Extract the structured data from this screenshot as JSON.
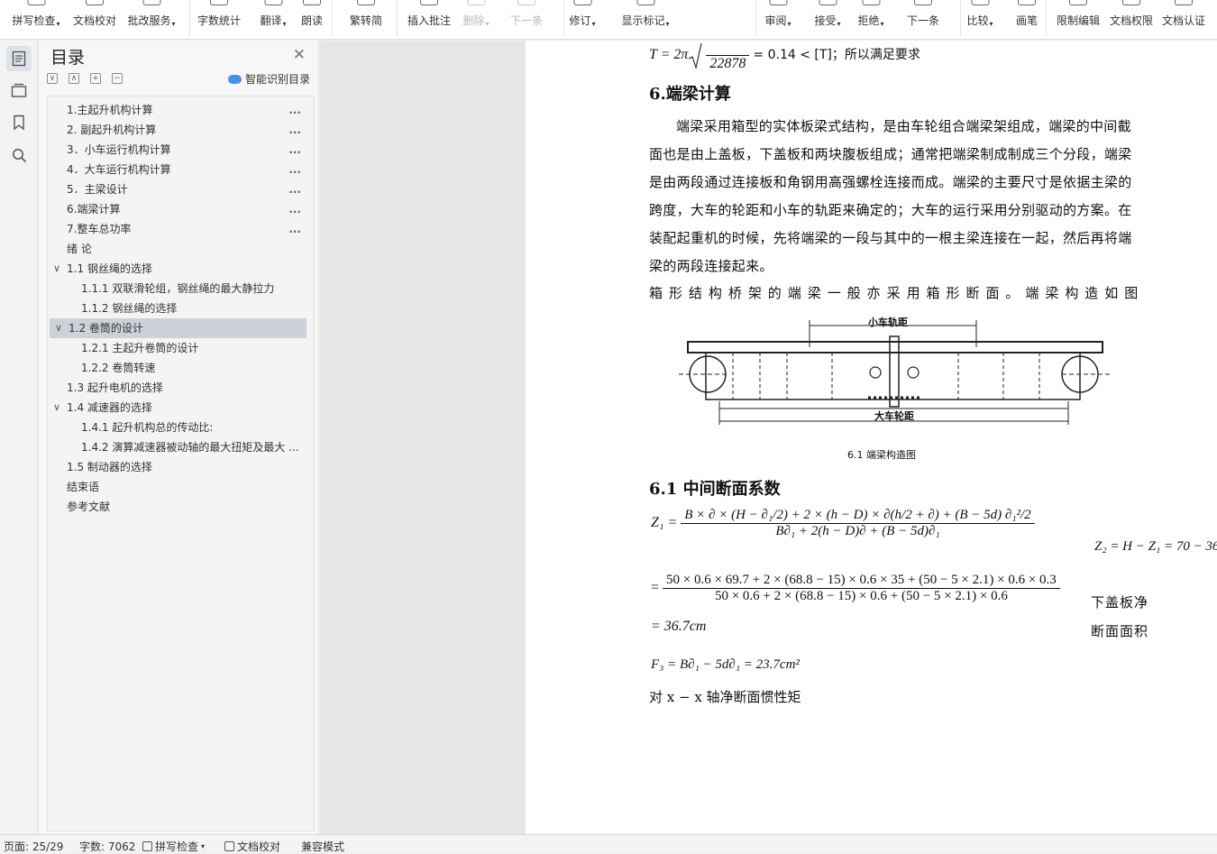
{
  "ribbon": {
    "items": [
      {
        "label": "拼写检查",
        "icon": "spell-check-icon",
        "caret": true,
        "disabled": false
      },
      {
        "label": "文档校对",
        "icon": "proofread-icon",
        "caret": false,
        "disabled": false
      },
      {
        "label": "批改服务",
        "icon": "correction-service-icon",
        "caret": true,
        "disabled": false
      },
      {
        "label": "字数统计",
        "icon": "word-count-icon",
        "caret": false,
        "disabled": false
      },
      {
        "label": "翻译",
        "icon": "translate-icon",
        "caret": true,
        "disabled": false
      },
      {
        "label": "朗读",
        "icon": "read-aloud-icon",
        "caret": false,
        "disabled": false
      },
      {
        "label": "繁转简",
        "icon": "trad-to-simp-icon",
        "caret": false,
        "disabled": false
      },
      {
        "label": "插入批注",
        "icon": "insert-comment-icon",
        "caret": false,
        "disabled": false
      },
      {
        "label": "删除",
        "icon": "delete-comment-icon",
        "caret": true,
        "disabled": true
      },
      {
        "label": "下一条",
        "icon": "next-comment-icon",
        "caret": false,
        "disabled": true
      },
      {
        "label": "修订",
        "icon": "track-changes-icon",
        "caret": true,
        "disabled": false
      },
      {
        "label": "显示标记",
        "icon": "show-markup-icon",
        "caret": true,
        "disabled": false
      },
      {
        "label": "审阅",
        "icon": "review-icon",
        "caret": true,
        "disabled": false
      },
      {
        "label": "接受",
        "icon": "accept-icon",
        "caret": true,
        "disabled": false
      },
      {
        "label": "拒绝",
        "icon": "reject-icon",
        "caret": true,
        "disabled": false
      },
      {
        "label": "下一条",
        "icon": "next-change-icon",
        "caret": false,
        "disabled": false
      },
      {
        "label": "比较",
        "icon": "compare-icon",
        "caret": true,
        "disabled": false
      },
      {
        "label": "画笔",
        "icon": "pen-icon",
        "caret": false,
        "disabled": false
      },
      {
        "label": "限制编辑",
        "icon": "restrict-editing-icon",
        "caret": false,
        "disabled": false
      },
      {
        "label": "文档权限",
        "icon": "document-permission-icon",
        "caret": false,
        "disabled": false
      },
      {
        "label": "文档认证",
        "icon": "document-certify-icon",
        "caret": false,
        "disabled": false
      }
    ]
  },
  "toc": {
    "title": "目录",
    "smart_label": "智能识别目录",
    "items": [
      {
        "label": "1.主起升机构计算",
        "indent": 0,
        "dots": true,
        "arrow": ""
      },
      {
        "label": "2. 副起升机构计算",
        "indent": 0,
        "dots": true,
        "arrow": ""
      },
      {
        "label": "3．小车运行机构计算",
        "indent": 0,
        "dots": true,
        "arrow": ""
      },
      {
        "label": "4．大车运行机构计算",
        "indent": 0,
        "dots": true,
        "arrow": ""
      },
      {
        "label": "5．主梁设计",
        "indent": 0,
        "dots": true,
        "arrow": ""
      },
      {
        "label": "6.端梁计算",
        "indent": 0,
        "dots": true,
        "arrow": ""
      },
      {
        "label": "7.整车总功率",
        "indent": 0,
        "dots": true,
        "arrow": ""
      },
      {
        "label": "绪 论",
        "indent": 0,
        "dots": false,
        "arrow": ""
      },
      {
        "label": "1.1 钢丝绳的选择",
        "indent": 0,
        "dots": false,
        "arrow": "∨"
      },
      {
        "label": "1.1.1 双联滑轮组，钢丝绳的最大静拉力",
        "indent": 1,
        "dots": false,
        "arrow": ""
      },
      {
        "label": "1.1.2 钢丝绳的选择",
        "indent": 1,
        "dots": false,
        "arrow": ""
      },
      {
        "label": "1.2 卷筒的设计",
        "indent": 0,
        "dots": false,
        "arrow": "∨",
        "selected": true
      },
      {
        "label": "1.2.1 主起升卷筒的设计",
        "indent": 1,
        "dots": false,
        "arrow": ""
      },
      {
        "label": "1.2.2 卷筒转速",
        "indent": 1,
        "dots": false,
        "arrow": ""
      },
      {
        "label": "1.3 起升电机的选择",
        "indent": 0,
        "dots": false,
        "arrow": ""
      },
      {
        "label": "1.4 减速器的选择",
        "indent": 0,
        "dots": false,
        "arrow": "∨"
      },
      {
        "label": "1.4.1 起升机构总的传动比:",
        "indent": 1,
        "dots": false,
        "arrow": ""
      },
      {
        "label": "1.4.2 演算减速器被动轴的最大扭矩及最大 ...",
        "indent": 1,
        "dots": false,
        "arrow": ""
      },
      {
        "label": "1.5 制动器的选择",
        "indent": 0,
        "dots": false,
        "arrow": ""
      },
      {
        "label": "结束语",
        "indent": 0,
        "dots": false,
        "arrow": ""
      },
      {
        "label": "参考文献",
        "indent": 0,
        "dots": false,
        "arrow": ""
      }
    ]
  },
  "document": {
    "top_formula_den": "22878",
    "top_formula_rest": "= 0.14 < [T]；所以满足要求",
    "section_heading": "6.端梁计算",
    "para_lines": [
      "端梁采用箱型的实体板梁式结构，是由车轮组合端梁架组成，端梁的中间截",
      "面也是由上盖板，下盖板和两块腹板组成；通常把端梁制成制成三个分段，端梁",
      "是由两段通过连接板和角钢用高强螺栓连接而成。端梁的主要尺寸是依据主梁的",
      "跨度，大车的轮距和小车的轨距来确定的；大车的运行采用分别驱动的方案。在",
      "装配起重机的时候，先将端梁的一段与其中的一根主梁连接在一起，然后再将端",
      "梁的两段连接起来。"
    ],
    "para_spaced": "箱 形 结 构 桥 架 的 端 梁 一 般 亦 采 用 箱 形 断 面 。 端 梁 构 造 如 图",
    "figure_top_label": "小车轨距",
    "figure_bottom_label": "大车轮距",
    "figure_caption": "6.1 端梁构造图",
    "subheading": "6.1 中间断面系数",
    "z1_label": "Z₁ =",
    "z1_num": "B × ∂ × (H − ∂₁/2) + 2 × (h − D) × ∂(h/2 + ∂) + (B − 5d) ∂₁²/2",
    "z1_den": "B∂₁ + 2(h − D)∂ + (B − 5d)∂₁",
    "z2": "Z₂ = H − Z₁ = 70 − 36",
    "calc_num": "50 × 0.6 × 69.7 + 2 × (68.8 − 15) × 0.6 × 35 + (50 − 5 × 2.1) × 0.6 × 0.3",
    "calc_den": "50 × 0.6 + 2 × (68.8 − 15) × 0.6 + (50 − 5 × 2.1) × 0.6",
    "result": "= 36.7cm",
    "side_text_1": "下盖板净",
    "side_text_2": "断面面积",
    "f3": "F₃ = B∂₁ − 5d∂₁ = 23.7cm²",
    "last_line": "对 x − x 轴净断面惯性矩"
  },
  "status": {
    "page": "页面: 25/29",
    "words": "字数: 7062",
    "spell": "拼写检查",
    "proof": "文档校对",
    "mode": "兼容模式"
  }
}
